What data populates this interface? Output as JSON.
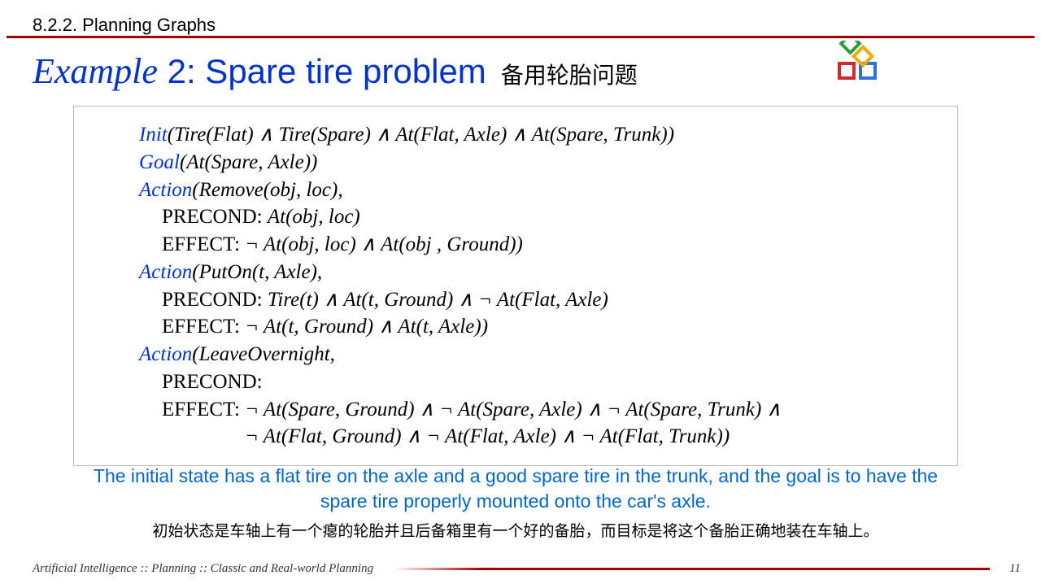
{
  "header": {
    "section": "8.2.2. Planning Graphs"
  },
  "title": {
    "example_label": "Example",
    "example_num_text": " 2: Spare tire problem",
    "zh": "备用轮胎问题"
  },
  "code": {
    "l1_kw": "Init",
    "l1_rest": "(Tire(Flat) ∧ Tire(Spare) ∧ At(Flat, Axle) ∧ At(Spare, Trunk))",
    "l2_kw": "Goal",
    "l2_rest": "(At(Spare, Axle))",
    "l3_kw": "Action",
    "l3_rest": "(Remove(obj, loc),",
    "l4_pre": "PRECOND: ",
    "l4_rest": "At(obj, loc)",
    "l5_pre": "EFFECT: ",
    "l5_rest": "¬ At(obj, loc) ∧ At(obj , Ground))",
    "l6_kw": "Action",
    "l6_rest": "(PutOn(t, Axle),",
    "l7_pre": "PRECOND: ",
    "l7_rest": "Tire(t) ∧ At(t, Ground) ∧ ¬ At(Flat, Axle)",
    "l8_pre": "EFFECT: ",
    "l8_rest": "¬ At(t, Ground) ∧ At(t, Axle))",
    "l9_kw": "Action",
    "l9_rest": "(LeaveOvernight,",
    "l10_pre": "PRECOND:",
    "l11_pre": "EFFECT: ",
    "l11_rest": "¬ At(Spare, Ground) ∧ ¬ At(Spare, Axle) ∧ ¬ At(Spare, Trunk) ∧",
    "l12_rest": "¬ At(Flat, Ground) ∧ ¬ At(Flat, Axle) ∧ ¬ At(Flat, Trunk))"
  },
  "statement": {
    "en": "The initial state has a flat tire on the axle and a good spare tire in the trunk, and the goal is to have the spare tire properly mounted onto the car's axle.",
    "zh": "初始状态是车轴上有一个瘪的轮胎并且后备箱里有一个好的备胎，而目标是将这个备胎正确地装在车轴上。"
  },
  "footer": {
    "breadcrumb": "Artificial Intelligence :: Planning :: Classic and Real-world Planning",
    "page": "11"
  }
}
